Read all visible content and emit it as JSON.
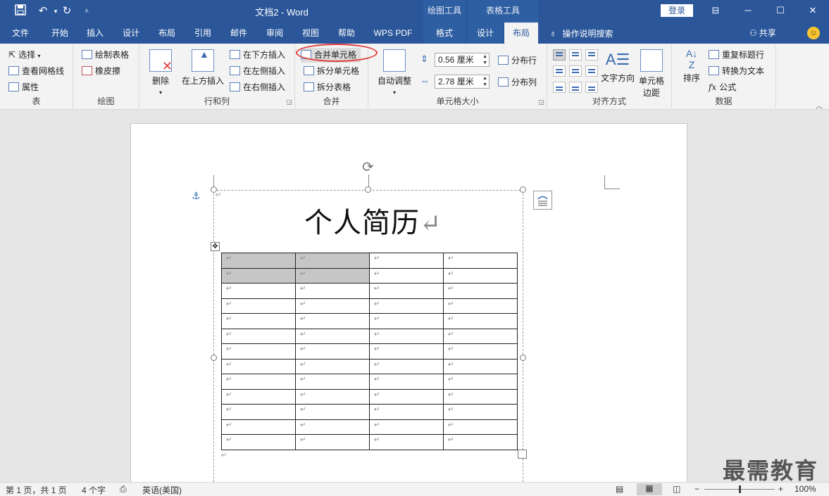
{
  "titlebar": {
    "title": "文档2 - Word",
    "context_draw": "绘图工具",
    "context_table": "表格工具",
    "login": "登录",
    "save_icon": "save-icon",
    "undo_icon": "undo-icon",
    "redo_icon": "redo-icon"
  },
  "tabs": [
    {
      "label": "文件"
    },
    {
      "label": "开始"
    },
    {
      "label": "插入"
    },
    {
      "label": "设计"
    },
    {
      "label": "布局"
    },
    {
      "label": "引用"
    },
    {
      "label": "邮件"
    },
    {
      "label": "审阅"
    },
    {
      "label": "视图"
    },
    {
      "label": "帮助"
    },
    {
      "label": "WPS PDF"
    },
    {
      "label": "格式"
    },
    {
      "label": "设计"
    },
    {
      "label": "布局"
    }
  ],
  "tell_me": "操作说明搜索",
  "share": "共享",
  "ribbon": {
    "group_table": {
      "label": "表",
      "select": "选择",
      "gridlines": "查看网格线",
      "properties": "属性"
    },
    "group_draw": {
      "label": "绘图",
      "draw_table": "绘制表格",
      "eraser": "橡皮擦"
    },
    "group_rows": {
      "label": "行和列",
      "delete": "删除",
      "insert_above": "在上方插入",
      "insert_below": "在下方插入",
      "insert_left": "在左侧插入",
      "insert_right": "在右侧插入"
    },
    "group_merge": {
      "label": "合并",
      "merge_cells": "合并单元格",
      "split_cells": "拆分单元格",
      "split_table": "拆分表格"
    },
    "group_size": {
      "label": "单元格大小",
      "autofit": "自动调整",
      "height": "0.56 厘米",
      "width": "2.78 厘米",
      "distribute_rows": "分布行",
      "distribute_cols": "分布列"
    },
    "group_align": {
      "label": "对齐方式",
      "text_direction": "文字方向",
      "cell_margins_1": "单元格",
      "cell_margins_2": "边距"
    },
    "group_data": {
      "label": "数据",
      "sort": "排序",
      "repeat_header": "重复标题行",
      "convert_text": "转换为文本",
      "formula": "公式"
    }
  },
  "document": {
    "heading": "个人简历",
    "paragraph_mark": "↵",
    "table_rows": 13,
    "table_cols": 4,
    "selected_cells": [
      [
        0,
        0
      ],
      [
        0,
        1
      ],
      [
        1,
        0
      ],
      [
        1,
        1
      ]
    ]
  },
  "watermark": "最需教育",
  "status": {
    "page": "第 1 页，共 1 页",
    "words": "4 个字",
    "language": "英语(美国)",
    "zoom": "100%"
  }
}
